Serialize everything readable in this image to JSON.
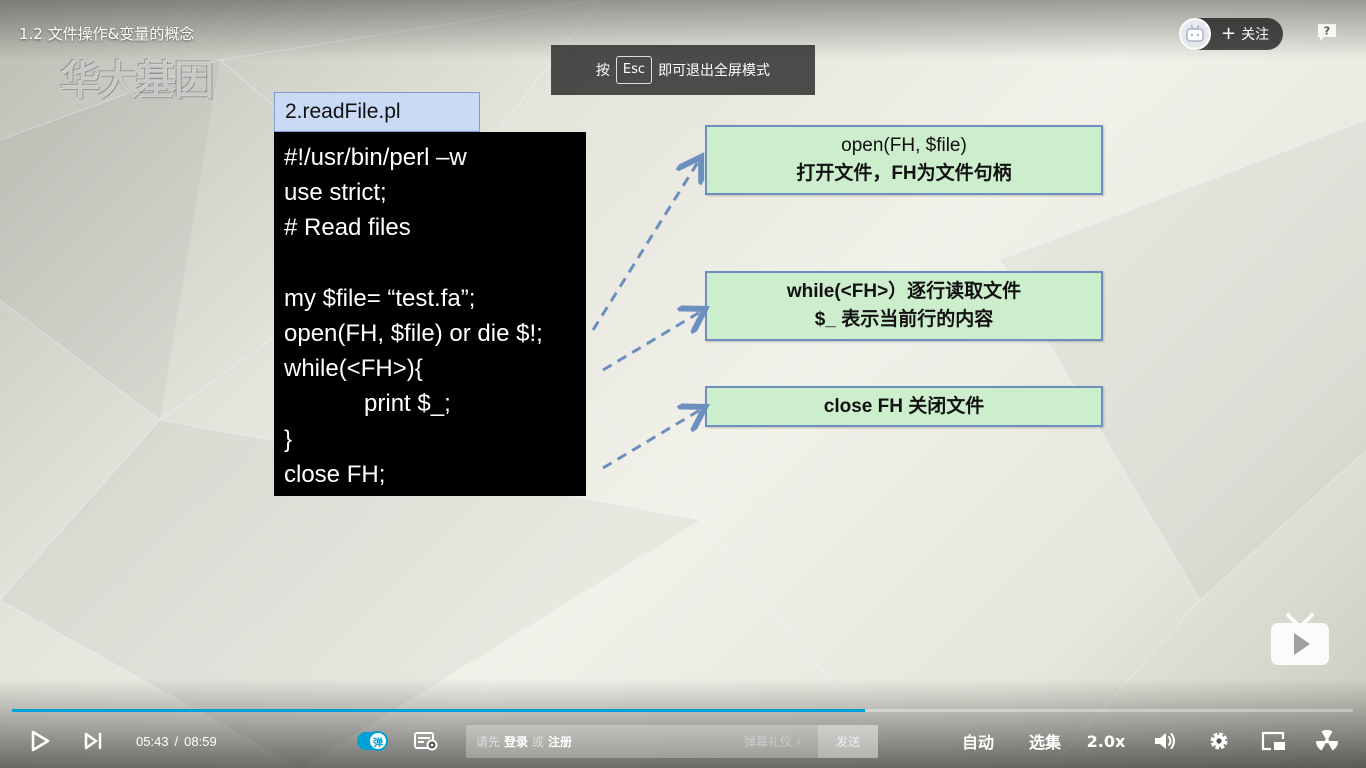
{
  "video": {
    "title": "1.2 文件操作&变量的概念",
    "watermark": "华大基因"
  },
  "fullscreen_tip": {
    "prefix": "按",
    "key": "Esc",
    "suffix": "即可退出全屏模式"
  },
  "uploader": {
    "follow_label": "关注",
    "follow_icon": "plus-icon",
    "avatar_icon": "tv-mascot-icon"
  },
  "slide": {
    "file_tab": "2.readFile.pl",
    "code_lines": [
      "#!/usr/bin/perl –w",
      "use strict;",
      "# Read files",
      "",
      "my $file= “test.fa”;",
      "open(FH, $file) or die $!;",
      "while(<FH>){",
      "            print $_;",
      "}",
      "close FH;"
    ],
    "notes": [
      {
        "line1": "open(FH, $file)",
        "line2": "打开文件，FH为文件句柄"
      },
      {
        "line1": "while(<FH>）逐行读取文件",
        "line2": "$_ 表示当前行的内容"
      },
      {
        "line1": "close  FH  关闭文件"
      }
    ]
  },
  "player": {
    "progress_fraction": 0.636,
    "current_time": "05:43",
    "separator": "/",
    "duration": "08:59",
    "danmaku_toggle_label": "弹",
    "danmaku_prompt_prefix": "请先",
    "danmaku_login": "登录",
    "danmaku_or": "或",
    "danmaku_register": "注册",
    "danmaku_etiquette": "弹幕礼仪 ›",
    "send_label": "发送",
    "auto_label": "自动",
    "episodes_label": "选集",
    "speed_label": "2.0x",
    "accent_color": "#00a1d6"
  }
}
